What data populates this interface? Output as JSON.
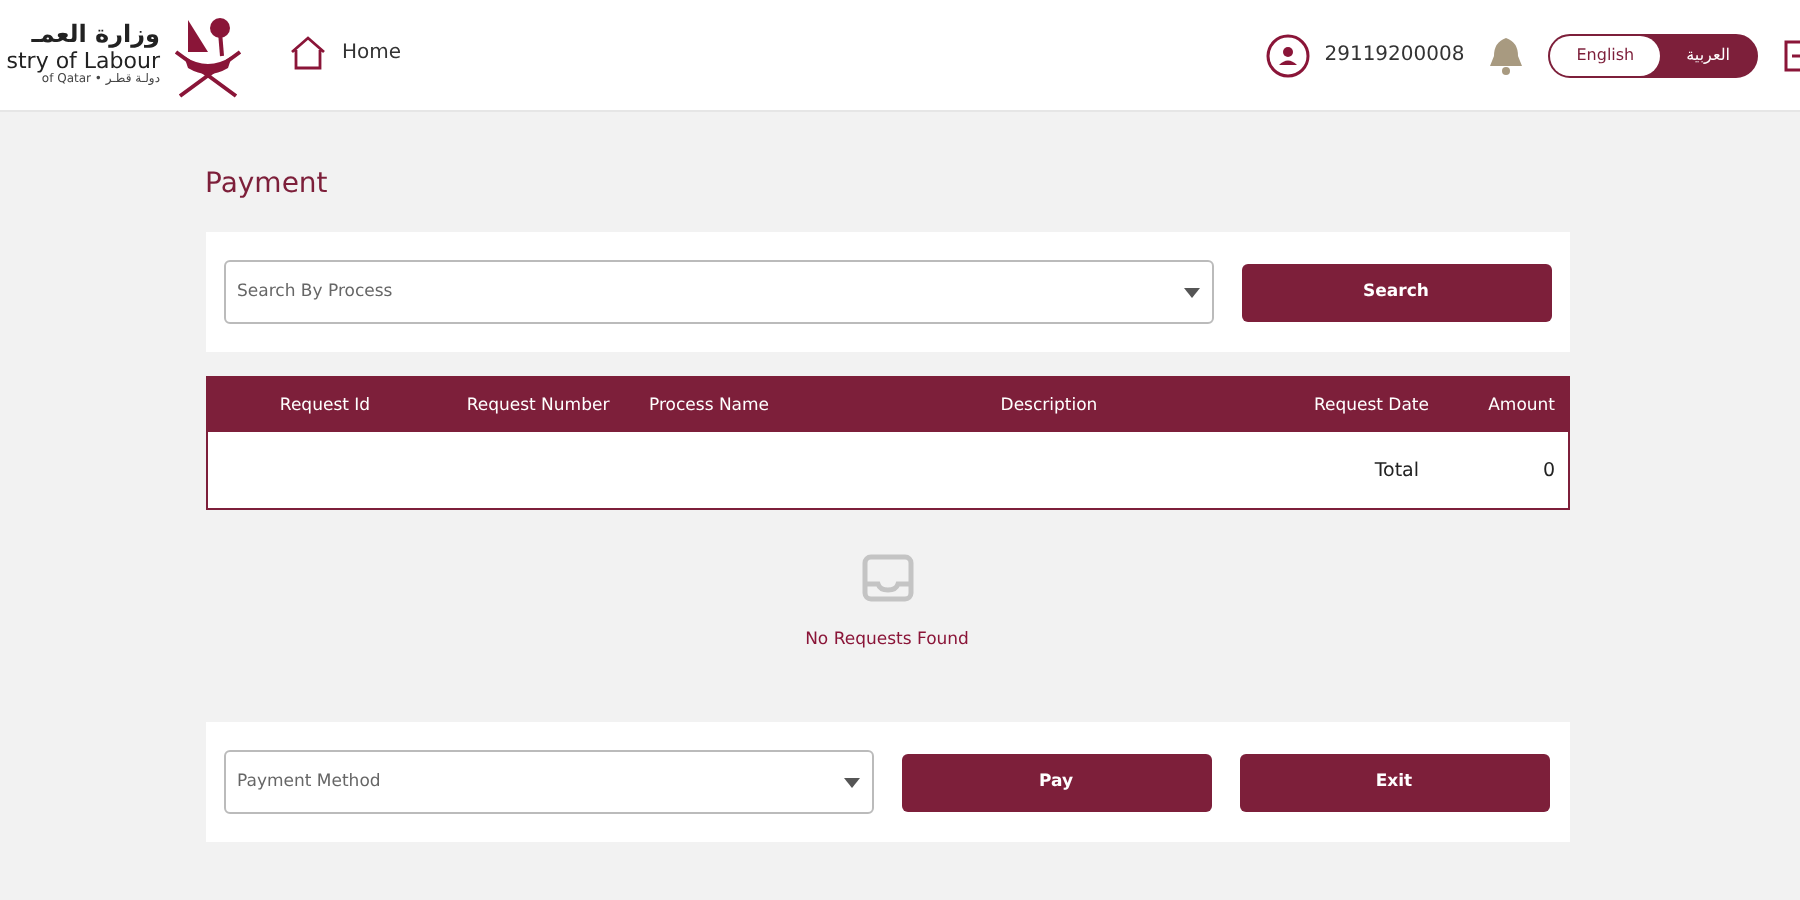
{
  "header": {
    "logo": {
      "arabic_name": "وزارة العمـ",
      "english_name": "stry of Labour",
      "country": "of Qatar • دولـة قطـر"
    },
    "home_link": "Home",
    "user_id": "29119200008",
    "languages": [
      {
        "label": "English",
        "selected": true
      },
      {
        "label": "العربية",
        "selected": false
      }
    ]
  },
  "page_title": "Payment",
  "search": {
    "process_select": {
      "placeholder": "Search By Process"
    },
    "button": "Search"
  },
  "table": {
    "columns": [
      "Request Id",
      "Request Number",
      "Process Name",
      "Description",
      "Request Date",
      "Amount"
    ],
    "total_label": "Total",
    "total_value": "0"
  },
  "empty_state": "No Requests Found",
  "payment": {
    "method_select": {
      "placeholder": "Payment Method"
    },
    "buttons": [
      "Pay",
      "Exit"
    ]
  }
}
